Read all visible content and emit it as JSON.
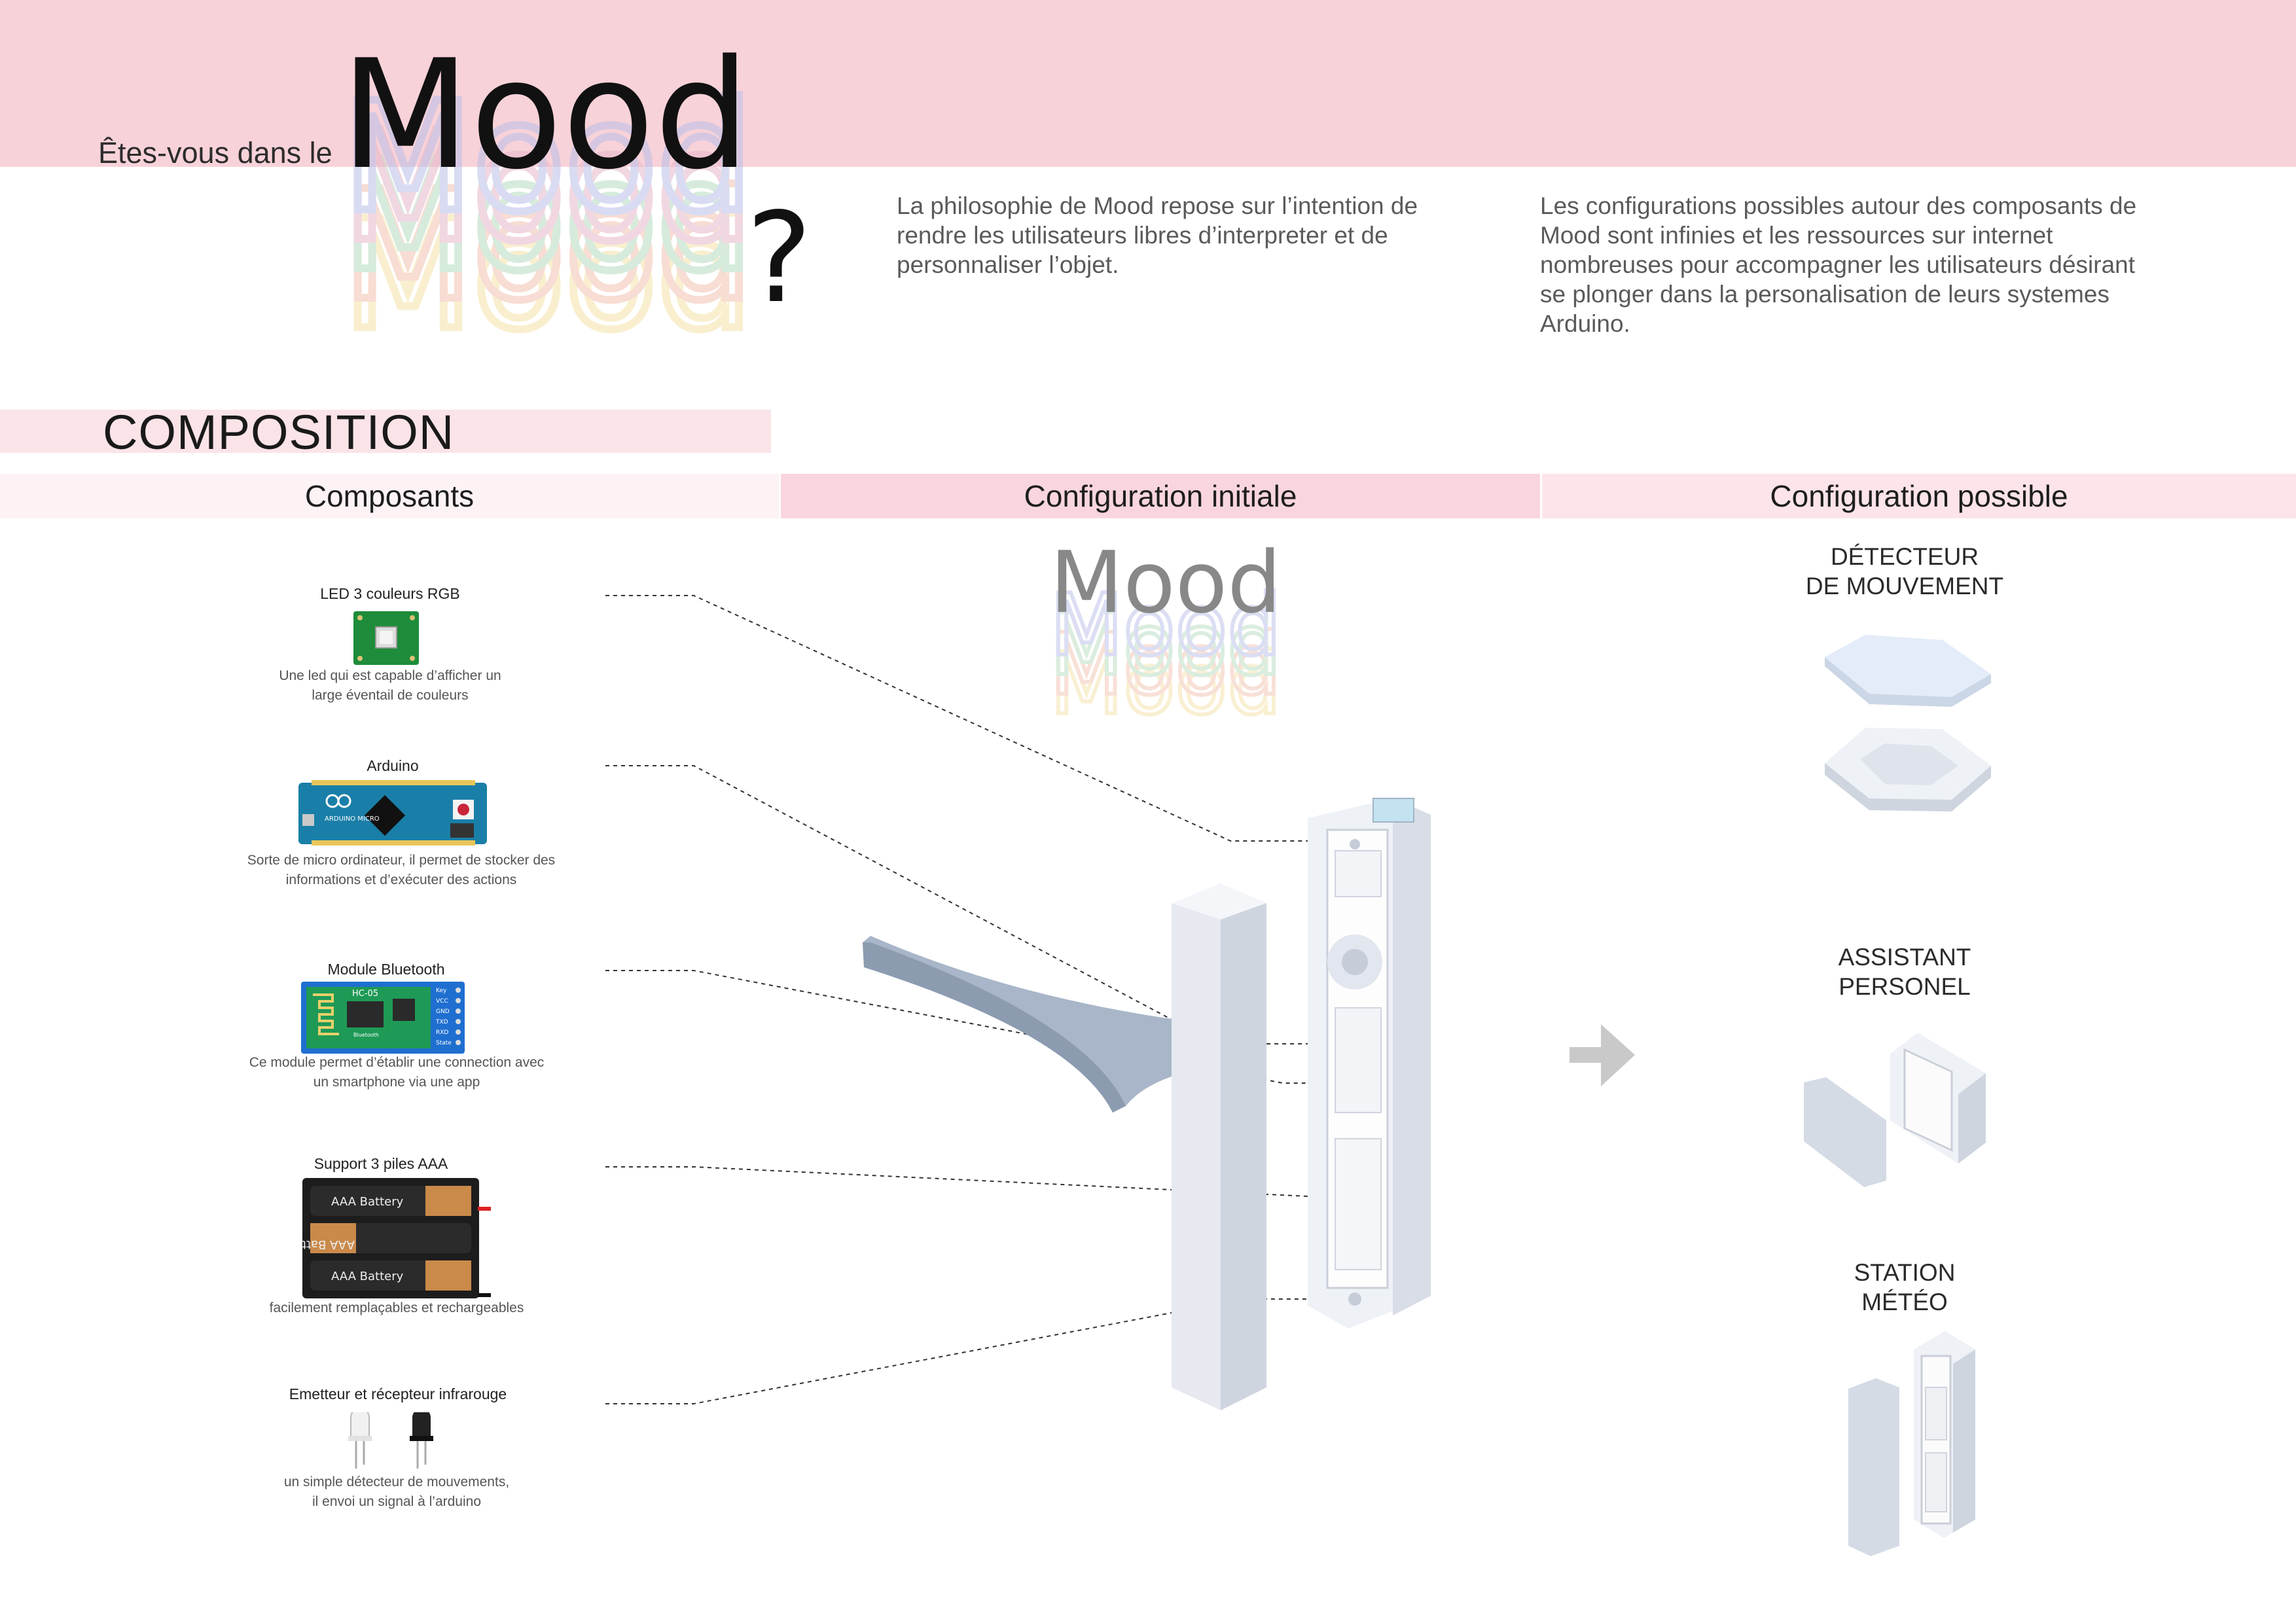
{
  "header": {
    "question_prefix": "Êtes-vous dans le",
    "brand": "Mood",
    "question_mark": "?",
    "intro_left": "La philosophie de Mood repose sur l’intention de rendre les utilisateurs libres d’interpreter et de personnaliser l’objet.",
    "intro_right": "Les configurations possibles autour des composants de Mood sont infinies et les ressources sur internet nombreuses pour accompagner les utilisateurs désirant se plonger dans la personalisation de leurs systemes Arduino."
  },
  "section_title": "COMPOSITION",
  "columns": {
    "components": "Composants",
    "initial": "Configuration initiale",
    "possible": "Configuration possible"
  },
  "components": [
    {
      "name": "LED 3 couleurs RGB",
      "desc_1": "Une led qui est capable d’afficher un",
      "desc_2": "large éventail de couleurs"
    },
    {
      "name": "Arduino",
      "desc_1": "Sorte de micro ordinateur, il permet de stocker des",
      "desc_2": "informations et d’exécuter des actions",
      "board_text": "ARDUINO MICRO"
    },
    {
      "name": "Module Bluetooth",
      "desc_1": "Ce module permet d’établir une connection avec",
      "desc_2": "un smartphone via une app",
      "chip_text": "HC-05",
      "chip_sub": "Bluetooth",
      "pins": [
        "Key",
        "VCC",
        "GND",
        "TXD",
        "RXD",
        "State"
      ]
    },
    {
      "name": "Support 3 piles AAA",
      "desc_1": "facilement remplaçables et rechargeables",
      "desc_2": "",
      "battery_label": "AAA Battery"
    },
    {
      "name": "Emetteur et récepteur infrarouge",
      "desc_1": "un simple détecteur de mouvements,",
      "desc_2": "il envoi un signal à l’arduino"
    }
  ],
  "configurations": [
    {
      "line_1": "DÉTECTEUR",
      "line_2": "DE MOUVEMENT"
    },
    {
      "line_1": "ASSISTANT",
      "line_2": "PERSONEL"
    },
    {
      "line_1": "STATION",
      "line_2": "MÉTÉO"
    }
  ],
  "colors": {
    "pink_band": "#f8d2d9",
    "echo_colors": [
      "#b9bfe8",
      "#b6dcc0",
      "#f2c2b0",
      "#f5e2a8",
      "#e7b7c9"
    ]
  }
}
